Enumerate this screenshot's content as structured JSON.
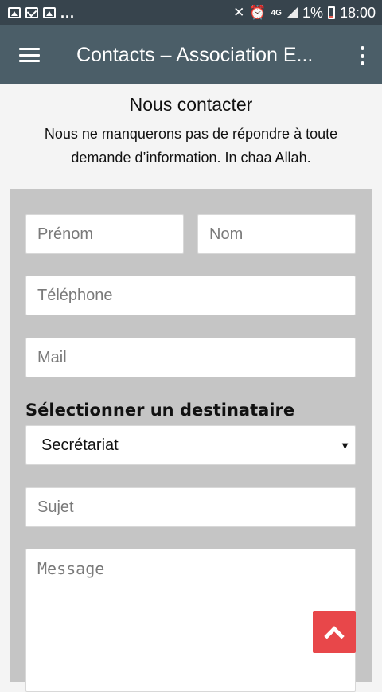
{
  "status_bar": {
    "more": "...",
    "network": "4G",
    "battery": "1%",
    "time": "18:00"
  },
  "app_bar": {
    "title": "Contacts – Association E..."
  },
  "intro": {
    "title": "Nous contacter",
    "text": "Nous ne manquerons pas de répondre à toute demande d’information. In chaa Allah."
  },
  "form": {
    "prenom_placeholder": "Prénom",
    "nom_placeholder": "Nom",
    "telephone_placeholder": "Téléphone",
    "mail_placeholder": "Mail",
    "select_label": "Sélectionner un destinataire",
    "select_value": "Secrétariat",
    "select_arrow": "▼",
    "sujet_placeholder": "Sujet",
    "message_placeholder": "Message"
  },
  "colors": {
    "status_bar": "#37444d",
    "app_bar": "#4b5e68",
    "panel": "#c5c5c5",
    "scroll_button": "#e8474a"
  }
}
